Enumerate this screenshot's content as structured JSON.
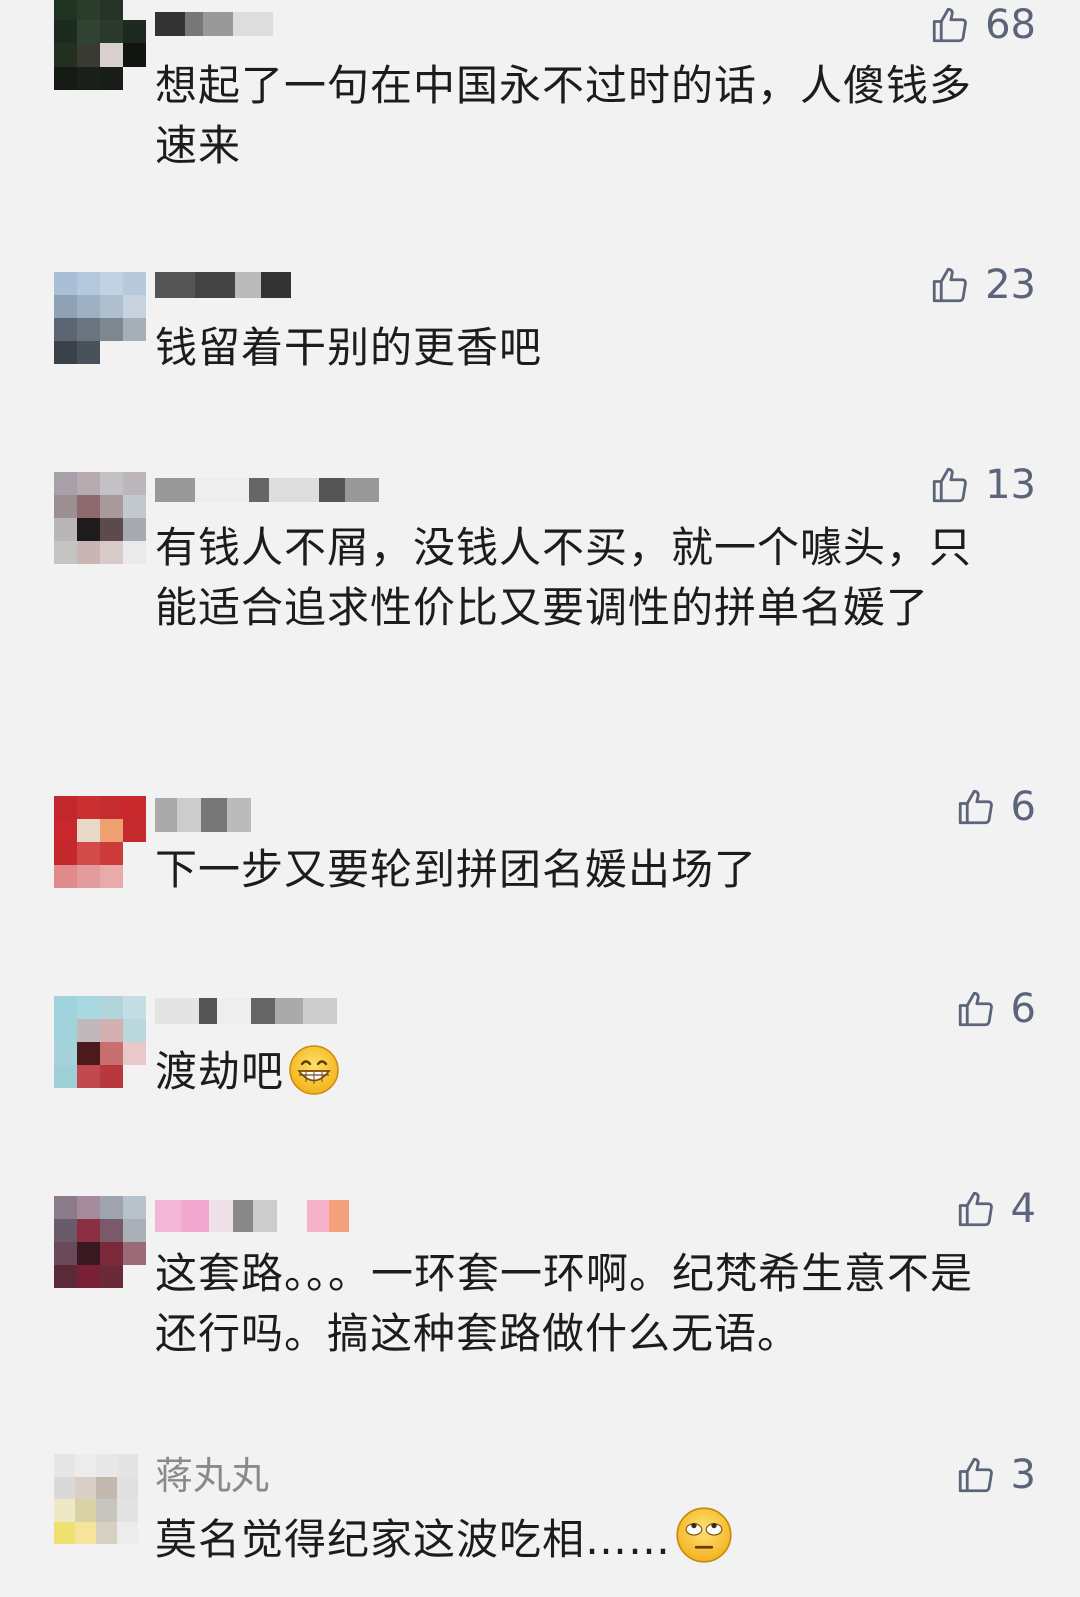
{
  "comments": [
    {
      "username": "",
      "text": "想起了一句在中国永不过时的话，人傻钱多速来",
      "likes": "68"
    },
    {
      "username": "",
      "text": "钱留着干别的更香吧",
      "likes": "23"
    },
    {
      "username": "",
      "text": "有钱人不屑，没钱人不买，就一个噱头，只能适合追求性价比又要调性的拼单名媛了",
      "likes": "13"
    },
    {
      "username": "",
      "text": "下一步又要轮到拼团名媛出场了",
      "likes": "6"
    },
    {
      "username": "",
      "text": "渡劫吧",
      "emoji": "grin-emoji",
      "likes": "6"
    },
    {
      "username": "",
      "text": "这套路。。。一环套一环啊。纪梵希生意不是还行吗。搞这种套路做什么无语。",
      "likes": "4"
    },
    {
      "username": "蒋丸丸",
      "text": "莫名觉得纪家这波吃相……",
      "emoji": "eye-roll-emoji",
      "likes": "3"
    }
  ],
  "icons": {
    "like": "thumbs-up-icon"
  },
  "colors": {
    "background": "#f2f2f2",
    "like": "#5b6478",
    "username": "#8a8a8a"
  }
}
